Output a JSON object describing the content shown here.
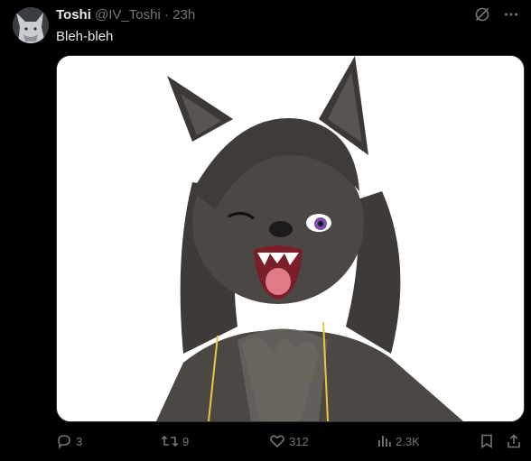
{
  "tweet": {
    "display_name": "Toshi",
    "handle": "@IV_Toshi",
    "separator": "·",
    "time": "23h",
    "text": "Bleh-bleh"
  },
  "actions": {
    "replies": "3",
    "reposts": "9",
    "likes": "312",
    "views": "2.3K"
  },
  "icons": [
    "grok-icon",
    "more-icon",
    "reply-icon",
    "repost-icon",
    "like-icon",
    "views-icon",
    "bookmark-icon",
    "share-icon"
  ],
  "colors": {
    "background": "#000000",
    "text": "#e7e9ea",
    "muted": "#71767b"
  }
}
